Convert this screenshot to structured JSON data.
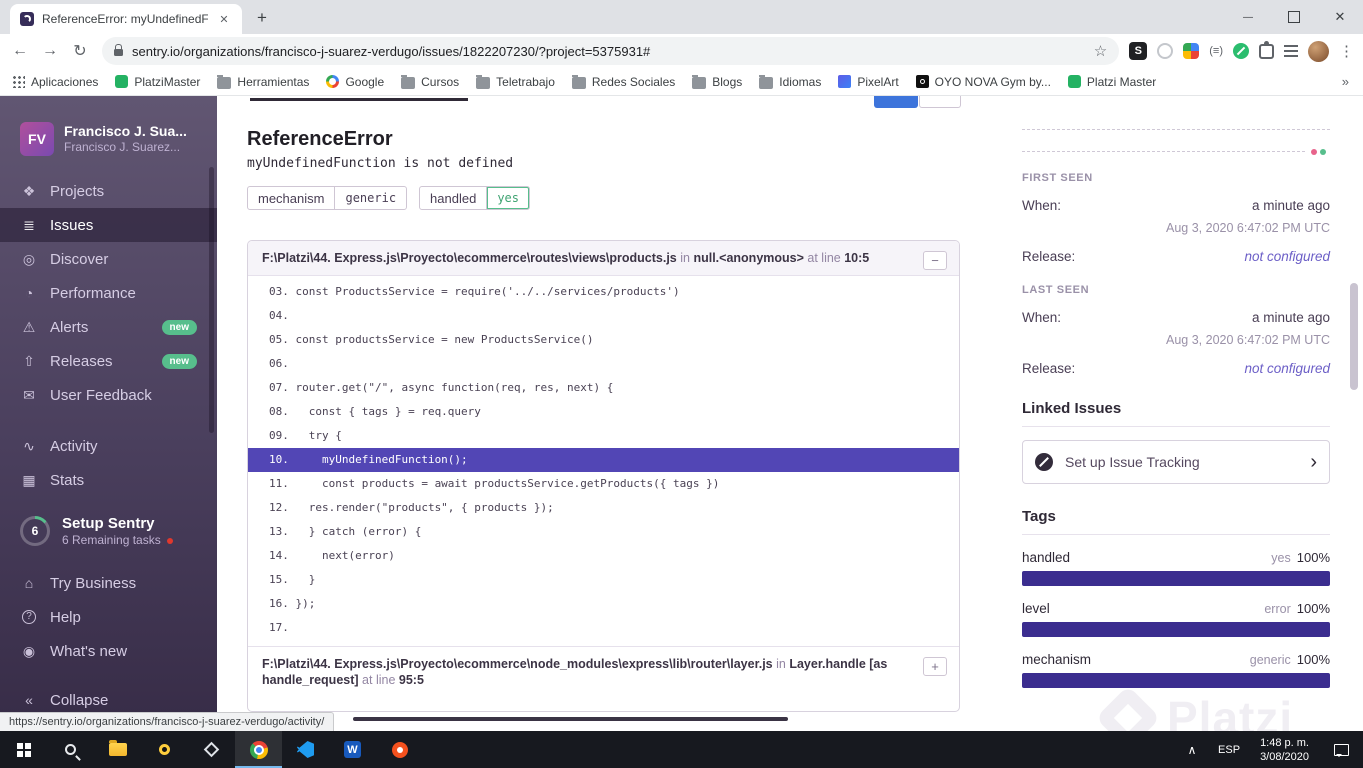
{
  "colors": {
    "accent_purple": "#6C5FC7",
    "highlight_line": "#5246b5",
    "success_green": "#57be8c",
    "tag_bar": "#3b2d8f"
  },
  "browser": {
    "tab_title": "ReferenceError: myUndefinedFun...",
    "url": "sentry.io/organizations/francisco-j-suarez-verdugo/issues/1822207230/?project=5375931#",
    "bookmarks": [
      {
        "icon": "apps",
        "label": "Aplicaciones"
      },
      {
        "icon": "platzi",
        "label": "PlatziMaster"
      },
      {
        "icon": "folder",
        "label": "Herramientas"
      },
      {
        "icon": "google",
        "label": "Google"
      },
      {
        "icon": "folder",
        "label": "Cursos"
      },
      {
        "icon": "folder",
        "label": "Teletrabajo"
      },
      {
        "icon": "folder",
        "label": "Redes Sociales"
      },
      {
        "icon": "folder",
        "label": "Blogs"
      },
      {
        "icon": "folder",
        "label": "Idiomas"
      },
      {
        "icon": "pixel",
        "label": "PixelArt"
      },
      {
        "icon": "oyo",
        "label": "OYO NOVA Gym by..."
      },
      {
        "icon": "platzi",
        "label": "Platzi Master"
      }
    ]
  },
  "sidebar": {
    "avatar_initials": "FV",
    "org_name": "Francisco J. Sua...",
    "org_subtitle": "Francisco J. Suarez...",
    "nav": [
      {
        "icon": "projects",
        "label": "Projects"
      },
      {
        "icon": "issues",
        "label": "Issues",
        "cls": "active"
      },
      {
        "icon": "discover",
        "label": "Discover"
      },
      {
        "icon": "performance",
        "label": "Performance"
      },
      {
        "icon": "alerts",
        "label": "Alerts",
        "badge": "new"
      },
      {
        "icon": "releases",
        "label": "Releases",
        "badge": "new"
      },
      {
        "icon": "feedback",
        "label": "User Feedback"
      }
    ],
    "nav2": [
      {
        "icon": "activity",
        "label": "Activity"
      },
      {
        "icon": "stats",
        "label": "Stats"
      }
    ],
    "setup": {
      "count": "6",
      "title": "Setup Sentry",
      "subtitle": "6 Remaining tasks"
    },
    "footer": [
      {
        "icon": "business",
        "label": "Try Business"
      },
      {
        "icon": "help",
        "label": "Help"
      },
      {
        "icon": "whatsnew",
        "label": "What's new"
      },
      {
        "icon": "collapse",
        "label": "Collapse",
        "cls": "collapse"
      }
    ]
  },
  "main": {
    "title": "ReferenceError",
    "subtitle": "myUndefinedFunction is not defined",
    "pills": [
      {
        "label": "mechanism",
        "value": "generic"
      },
      {
        "label": "handled",
        "value": "yes",
        "vcls": "green"
      }
    ],
    "frame1": {
      "path": "F:\\Platzi\\44. Express.js\\Proyecto\\ecommerce\\routes\\views\\products.js",
      "in_label": "in",
      "context": "null.<anonymous>",
      "at_label": "at line",
      "lineno": "10:5"
    },
    "code": [
      {
        "text": "03. const ProductsService = require('../../services/products')"
      },
      {
        "text": "04. "
      },
      {
        "text": "05. const productsService = new ProductsService()"
      },
      {
        "text": "06. "
      },
      {
        "text": "07. router.get(\"/\", async function(req, res, next) {"
      },
      {
        "text": "08.   const { tags } = req.query"
      },
      {
        "text": "09.   try {"
      },
      {
        "text": "10.     myUndefinedFunction();",
        "cls": "hl"
      },
      {
        "text": "11.     const products = await productsService.getProducts({ tags })"
      },
      {
        "text": "12.   res.render(\"products\", { products });"
      },
      {
        "text": "13.   } catch (error) {"
      },
      {
        "text": "14.     next(error)"
      },
      {
        "text": "15.   }"
      },
      {
        "text": "16. });"
      },
      {
        "text": "17. "
      }
    ],
    "frame2": {
      "path": "F:\\Platzi\\44. Express.js\\Proyecto\\ecommerce\\node_modules\\express\\lib\\router\\layer.js",
      "in_label": "in",
      "context": "Layer.handle [as handle_request]",
      "at_label": "at line",
      "lineno": "95:5"
    }
  },
  "panel": {
    "first_seen": {
      "label": "FIRST SEEN",
      "when_label": "When:",
      "when_value": "a minute ago",
      "date": "Aug 3, 2020 6:47:02 PM UTC",
      "release_label": "Release:",
      "release_value": "not configured"
    },
    "last_seen": {
      "label": "LAST SEEN",
      "when_label": "When:",
      "when_value": "a minute ago",
      "date": "Aug 3, 2020 6:47:02 PM UTC",
      "release_label": "Release:",
      "release_value": "not configured"
    },
    "linked_issues_title": "Linked Issues",
    "issue_tracking_label": "Set up Issue Tracking",
    "tags_title": "Tags",
    "tags": [
      {
        "name": "handled",
        "value": "yes",
        "percent": "100%"
      },
      {
        "name": "level",
        "value": "error",
        "percent": "100%"
      },
      {
        "name": "mechanism",
        "value": "generic",
        "percent": "100%"
      }
    ],
    "watermark": "Platzi"
  },
  "statusbar": {
    "url": "https://sentry.io/organizations/francisco-j-suarez-verdugo/activity/"
  },
  "taskbar": {
    "language": "ESP",
    "time": "1:48 p. m.",
    "date": "3/08/2020"
  }
}
